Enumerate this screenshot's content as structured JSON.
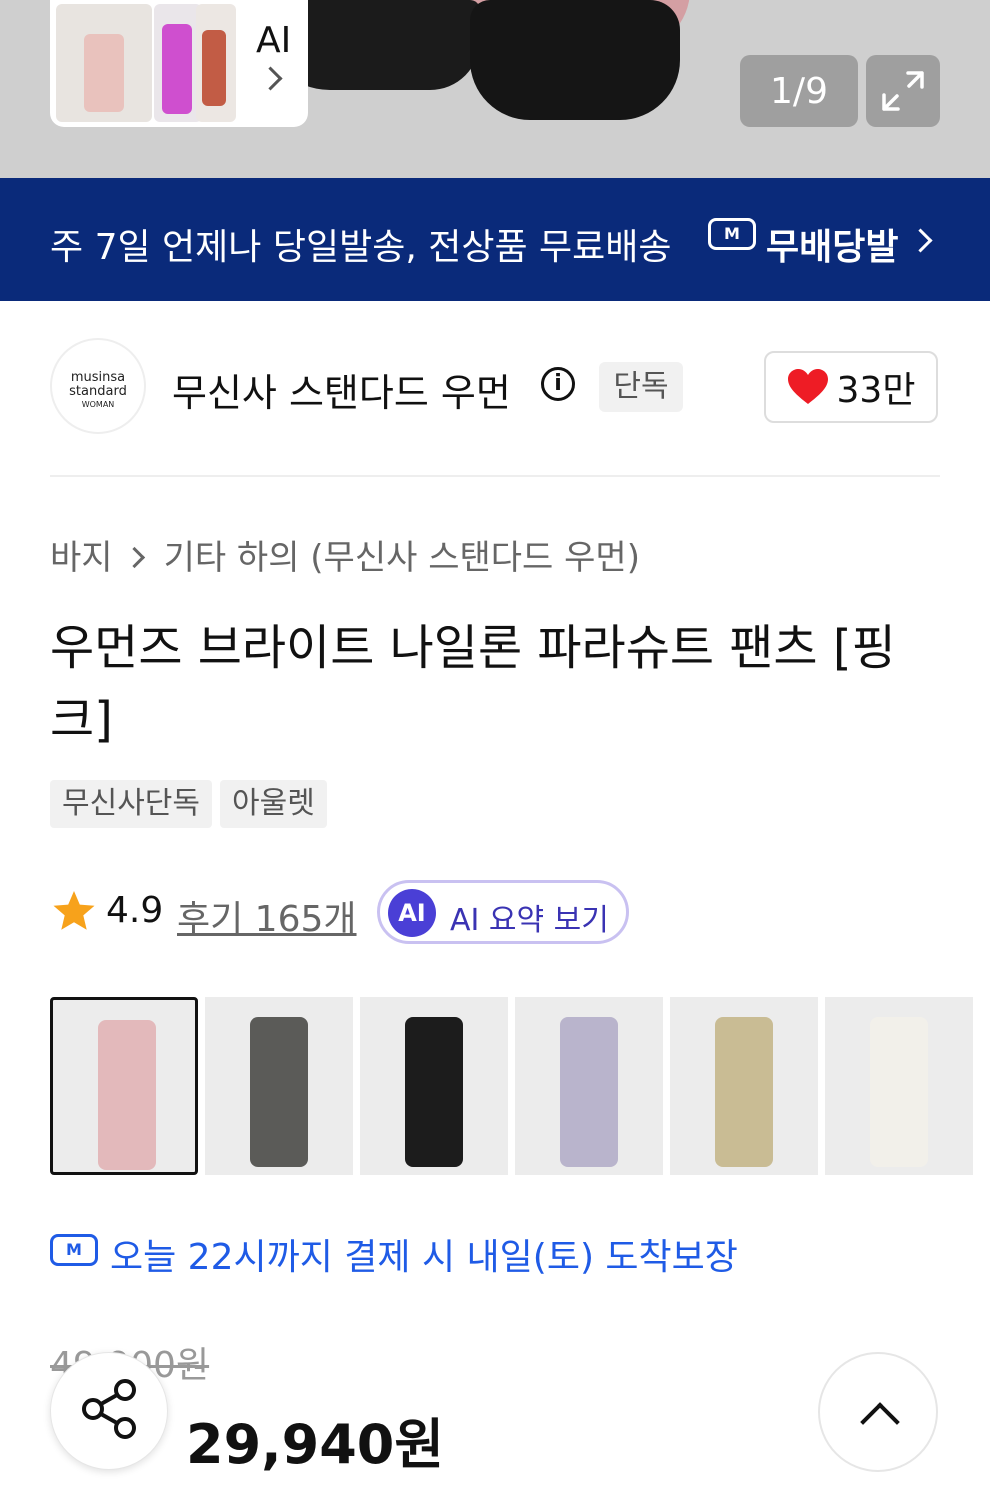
{
  "hero": {
    "ai_label": "AI",
    "counter": "1/9"
  },
  "banner": {
    "text": "주 7일 언제나 당일발송, 전상품 무료배송",
    "brand": "무배당발",
    "logo_mark": "M",
    "bg_color": "#0a2a7a"
  },
  "brand": {
    "logo_line1": "musinsa",
    "logo_line2": "standard",
    "logo_line3": "WOMAN",
    "name": "무신사 스탠다드 우먼",
    "info_mark": "i",
    "exclusive_tag": "단독",
    "likes": "33만"
  },
  "breadcrumb": {
    "category": "바지",
    "subcategory": "기타 하의 (무신사 스탠다드 우먼)"
  },
  "product": {
    "title": "우먼즈 브라이트 나일론 파라슈트 팬츠 [핑크]",
    "tags": [
      "무신사단독",
      "아울렛"
    ]
  },
  "rating": {
    "score": "4.9",
    "reviews": "후기 165개",
    "ai_badge": "AI",
    "ai_summary": "AI 요약 보기"
  },
  "thumbnails": [
    {
      "name": "pink",
      "color": "#e3b9bb"
    },
    {
      "name": "charcoal",
      "color": "#5b5b58"
    },
    {
      "name": "black",
      "color": "#1c1c1c"
    },
    {
      "name": "lavender",
      "color": "#b9b4cc"
    },
    {
      "name": "khaki",
      "color": "#c9bc94"
    },
    {
      "name": "ivory",
      "color": "#f2f0ea"
    }
  ],
  "delivery": {
    "logo_mark": "M",
    "text": "오늘 22시까지 결제 시 내일(토) 도착보장",
    "color": "#1f5be6"
  },
  "price": {
    "original": "49,900원",
    "current": "29,940원"
  }
}
